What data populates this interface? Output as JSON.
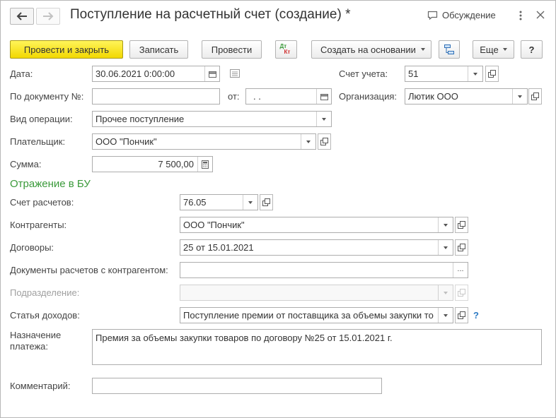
{
  "window": {
    "title": "Поступление на расчетный счет (создание) *",
    "discussion_label": "Обсуждение"
  },
  "toolbar": {
    "post_close": "Провести и закрыть",
    "save": "Записать",
    "post": "Провести",
    "dt": "Дт",
    "kt": "Кт",
    "create_based": "Создать на основании",
    "more": "Еще",
    "help": "?"
  },
  "form": {
    "date_label": "Дата:",
    "date_value": "30.06.2021  0:00:00",
    "account_label": "Счет учета:",
    "account_value": "51",
    "doc_label": "По документу №:",
    "doc_value": "",
    "from_label": "от:",
    "from_value": " .  .",
    "org_label": "Организация:",
    "org_value": "Лютик ООО",
    "op_label": "Вид операции:",
    "op_value": "Прочее поступление",
    "payer_label": "Плательщик:",
    "payer_value": "ООО \"Пончик\"",
    "sum_label": "Сумма:",
    "sum_value": "7 500,00"
  },
  "bu": {
    "section_title": "Отражение в БУ",
    "settle_label": "Счет расчетов:",
    "settle_value": "76.05",
    "contractors_label": "Контрагенты:",
    "contractors_value": "ООО \"Пончик\"",
    "contracts_label": "Договоры:",
    "contracts_value": "25 от 15.01.2021",
    "docs_label": "Документы расчетов с контрагентом:",
    "docs_value": "",
    "dept_label": "Подразделение:",
    "dept_value": "",
    "income_label": "Статья доходов:",
    "income_value": "Поступление премии от поставщика за объемы закупки то",
    "income_help": "?"
  },
  "purpose": {
    "label_line1": "Назначение",
    "label_line2": "платежа:",
    "value": "Премия за объемы закупки товаров по договору №25 от 15.01.2021 г."
  },
  "comment": {
    "label": "Комментарий:",
    "value": ""
  },
  "ellipsis": "...",
  "colors": {
    "primary_button": "#f2d800",
    "section_title": "#3a9a3a",
    "help_link": "#2d7bc4"
  }
}
